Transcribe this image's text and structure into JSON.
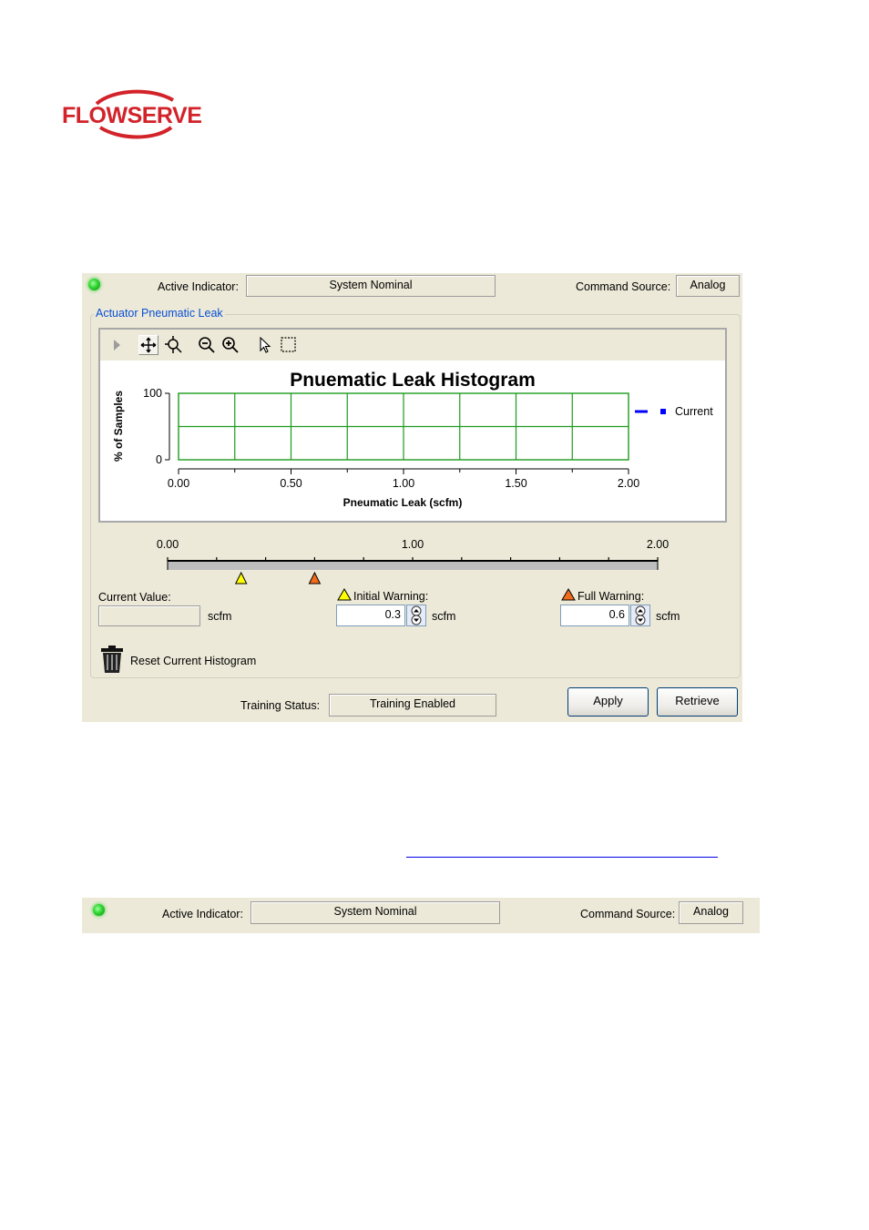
{
  "brand": {
    "logo_text": "FLOWSERVE",
    "color": "#d2232a"
  },
  "top_status": {
    "active_indicator_label": "Active Indicator:",
    "active_indicator_value": "System Nominal",
    "command_source_label": "Command Source:",
    "command_source_value": "Analog"
  },
  "group": {
    "title": "Actuator Pneumatic Leak"
  },
  "toolbar": {
    "icons": [
      "play-icon",
      "pan-icon",
      "zoom-pan-icon",
      "zoom-out-icon",
      "zoom-in-icon",
      "pointer-icon",
      "select-box-icon"
    ]
  },
  "chart_data": {
    "type": "bar",
    "title": "Pnuematic Leak Histogram",
    "xlabel": "Pneumatic Leak (scfm)",
    "ylabel": "% of Samples",
    "xlim": [
      0,
      2.0
    ],
    "ylim": [
      0,
      100
    ],
    "x_ticks": [
      "0.00",
      "0.50",
      "1.00",
      "1.50",
      "2.00"
    ],
    "y_ticks": [
      "0",
      "100"
    ],
    "grid": true,
    "grid_color": "#1c9a1c",
    "legend_position": "right",
    "series": [
      {
        "name": "Current",
        "color": "#0000ff",
        "values": []
      }
    ]
  },
  "scale": {
    "labels": [
      "0.00",
      "1.00",
      "2.00"
    ],
    "min": 0,
    "max": 2.0,
    "initial_warning_marker": 0.3,
    "full_warning_marker": 0.6
  },
  "current_value": {
    "label": "Current Value:",
    "value": "",
    "unit": "scfm"
  },
  "initial_warning": {
    "label": "Initial Warning:",
    "value": "0.3",
    "unit": "scfm",
    "color": "#ffff00"
  },
  "full_warning": {
    "label": "Full Warning:",
    "value": "0.6",
    "unit": "scfm",
    "color": "#f26b1d"
  },
  "reset": {
    "label": "Reset Current Histogram"
  },
  "training": {
    "label": "Training Status:",
    "value": "Training Enabled"
  },
  "buttons": {
    "apply": "Apply",
    "retrieve": "Retrieve"
  },
  "bottom_status": {
    "active_indicator_label": "Active Indicator:",
    "active_indicator_value": "System Nominal",
    "command_source_label": "Command Source:",
    "command_source_value": "Analog"
  }
}
